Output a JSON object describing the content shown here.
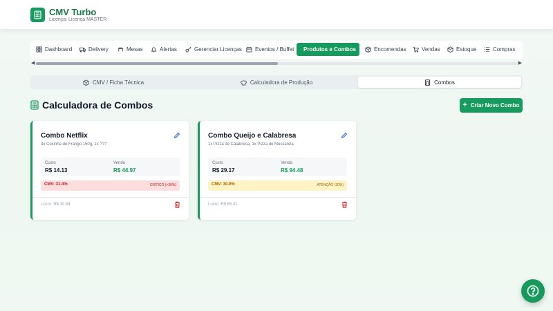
{
  "app": {
    "title": "CMV Turbo",
    "subtitle": "Licença: Licença MASTER",
    "logo_icon": "calculator-icon",
    "accent_color": "#169a5e"
  },
  "nav": {
    "tabs": [
      {
        "label": "Dashboard",
        "icon": "dashboard-icon",
        "active": false
      },
      {
        "label": "Delivery",
        "icon": "truck-icon",
        "active": false
      },
      {
        "label": "Mesas",
        "icon": "table-icon",
        "active": false
      },
      {
        "label": "Alertas",
        "icon": "bell-icon",
        "active": false
      },
      {
        "label": "Gerenciar Licenças",
        "icon": "key-icon",
        "active": false
      },
      {
        "label": "Eventos / Buffet",
        "icon": "calendar-icon",
        "active": false
      },
      {
        "label": "Produtos e Combos",
        "icon": "document-icon",
        "active": true
      },
      {
        "label": "Encomendas",
        "icon": "package-icon",
        "active": false
      },
      {
        "label": "Vendas",
        "icon": "cart-icon",
        "active": false
      },
      {
        "label": "Estoque",
        "icon": "box-icon",
        "active": false
      },
      {
        "label": "Compras",
        "icon": "list-icon",
        "active": false
      }
    ]
  },
  "subtabs": [
    {
      "label": "CMV / Ficha Técnica",
      "icon": "cube-icon",
      "active": false
    },
    {
      "label": "Calculadora de Produção",
      "icon": "chef-hat-icon",
      "active": false
    },
    {
      "label": "Combos",
      "icon": "calculator-icon",
      "active": true
    }
  ],
  "main": {
    "title": "Calculadora de Combos",
    "create_button": "Criar Novo Combo"
  },
  "combos": [
    {
      "name": "Combo Netflix",
      "items": "3x Coxinha de Frango 150g, 1x ???",
      "cost_label": "Custo",
      "cost": "R$ 14.13",
      "sale_label": "Venda",
      "sale": "R$ 44.97",
      "cmv": "CMV: 31.4%",
      "status": "CRÍTICO (>30%)",
      "status_bg": "#fcdede",
      "status_color": "#b91c1c",
      "profit": "Lucro: R$ 30.84"
    },
    {
      "name": "Combo Queijo e Calabresa",
      "items": "1x Pizza de Calabresa, 1x Pizza de Mussarela",
      "cost_label": "Custo",
      "cost": "R$ 29.17",
      "sale_label": "Venda",
      "sale": "R$ 94.48",
      "cmv": "CMV: 30.9%",
      "status": "ATENÇÃO (30%)",
      "status_bg": "#fdf3c4",
      "status_color": "#a16207",
      "profit": "Lucro: R$ 65.31"
    }
  ]
}
